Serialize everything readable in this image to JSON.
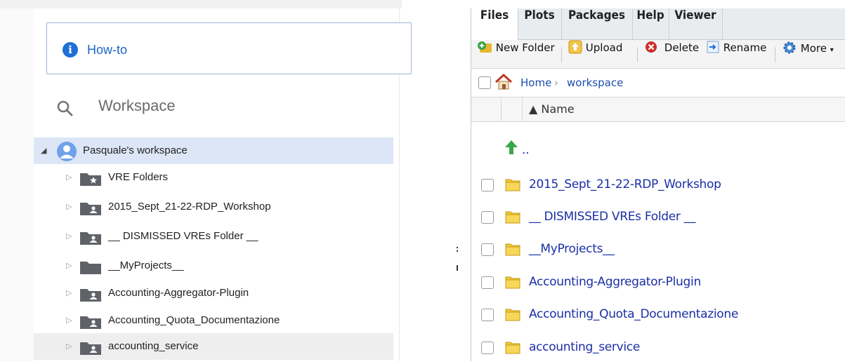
{
  "left": {
    "howto_label": "How-to",
    "workspace_title": "Workspace",
    "root_label": "Pasquale's workspace",
    "items": [
      {
        "label": "VRE Folders",
        "icon": "star-folder-icon"
      },
      {
        "label": "2015_Sept_21-22-RDP_Workshop",
        "icon": "shared-folder-icon"
      },
      {
        "label": "__ DISMISSED VREs Folder __",
        "icon": "shared-folder-icon"
      },
      {
        "label": "__MyProjects__",
        "icon": "folder-icon"
      },
      {
        "label": "Accounting-Aggregator-Plugin",
        "icon": "shared-folder-icon"
      },
      {
        "label": "Accounting_Quota_Documentazione",
        "icon": "shared-folder-icon"
      },
      {
        "label": "accounting_service",
        "icon": "shared-folder-icon"
      }
    ]
  },
  "right": {
    "tabs": [
      "Files",
      "Plots",
      "Packages",
      "Help",
      "Viewer"
    ],
    "active_tab": "Files",
    "toolbar": {
      "new_folder": "New Folder",
      "upload": "Upload",
      "delete": "Delete",
      "rename": "Rename",
      "more": "More"
    },
    "breadcrumb": {
      "home": "Home",
      "sep": "›",
      "current": "workspace"
    },
    "column_header": "▲ Name",
    "up_label": "..",
    "files": [
      "2015_Sept_21-22-RDP_Workshop",
      "__ DISMISSED VREs Folder __",
      "__MyProjects__",
      "Accounting-Aggregator-Plugin",
      "Accounting_Quota_Documentazione",
      "accounting_service"
    ]
  },
  "colors": {
    "accent_blue": "#1b66c9",
    "link_blue": "#1b2fa5",
    "selection": "#dce6f6",
    "folder_yellow": "#f5c842"
  }
}
